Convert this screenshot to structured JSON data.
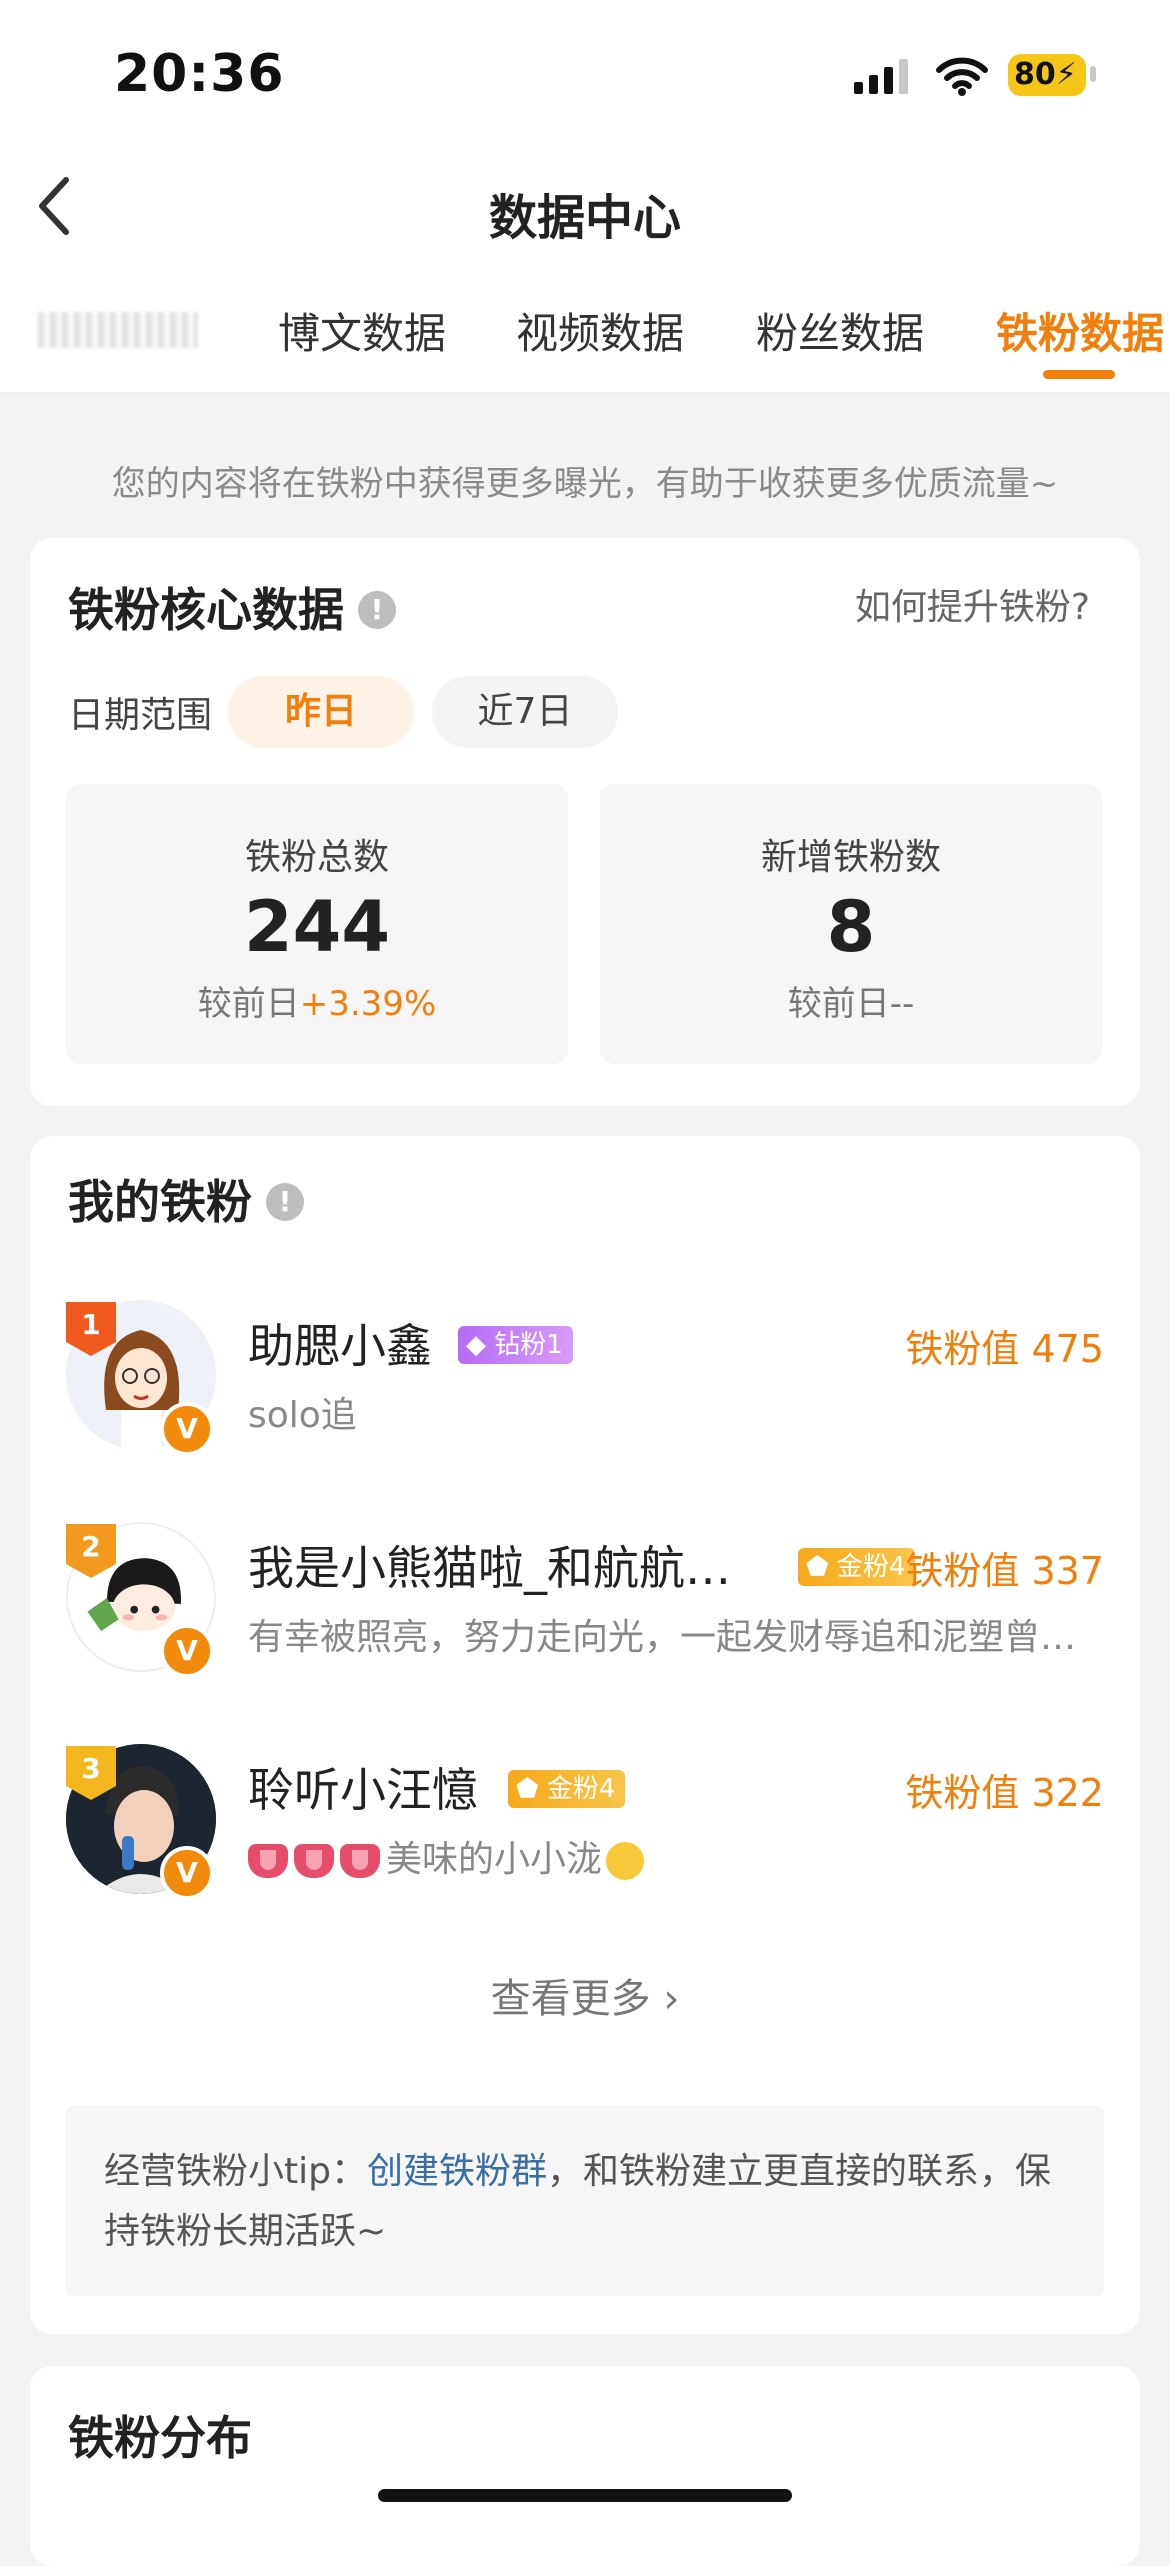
{
  "status_bar": {
    "time": "20:36",
    "battery": "80"
  },
  "header": {
    "title": "数据中心"
  },
  "tabs": [
    {
      "label": "博文数据",
      "active": false
    },
    {
      "label": "视频数据",
      "active": false
    },
    {
      "label": "粉丝数据",
      "active": false
    },
    {
      "label": "铁粉数据",
      "active": true
    }
  ],
  "hint": "您的内容将在铁粉中获得更多曝光，有助于收获更多优质流量~",
  "core": {
    "title": "铁粉核心数据",
    "info_icon": "!",
    "help_link": "如何提升铁粉?",
    "date_label": "日期范围",
    "date_options": [
      "昨日",
      "近7日"
    ],
    "selected_date": "昨日",
    "stats": [
      {
        "label": "铁粉总数",
        "value": "244",
        "compare_prefix": "较前日",
        "compare_value": "+3.39%"
      },
      {
        "label": "新增铁粉数",
        "value": "8",
        "compare_prefix": "较前日",
        "compare_value": "--"
      }
    ]
  },
  "fans": {
    "title": "我的铁粉",
    "info_icon": "!",
    "items": [
      {
        "rank": "1",
        "name": "助腮小鑫",
        "badge": "钻粉1",
        "value_text": "铁粉值 475",
        "subtitle": "solo追",
        "verify": "V"
      },
      {
        "rank": "2",
        "name": "我是小熊猫啦_和航航…",
        "badge": "金粉4",
        "value_text": "铁粉值 337",
        "subtitle": "有幸被照亮，努力走向光，一起发财辱追和泥塑曾…",
        "verify": "V"
      },
      {
        "rank": "3",
        "name": "聆听小汪憶",
        "badge": "金粉4",
        "value_text": "铁粉值 322",
        "subtitle": "美味的小小泷",
        "verify": "V"
      }
    ],
    "more": "查看更多",
    "tip_prefix": "经营铁粉小tip：",
    "tip_link": "创建铁粉群",
    "tip_suffix": "，和铁粉建立更直接的联系，保持铁粉长期活跃~"
  },
  "distribution": {
    "title": "铁粉分布"
  }
}
